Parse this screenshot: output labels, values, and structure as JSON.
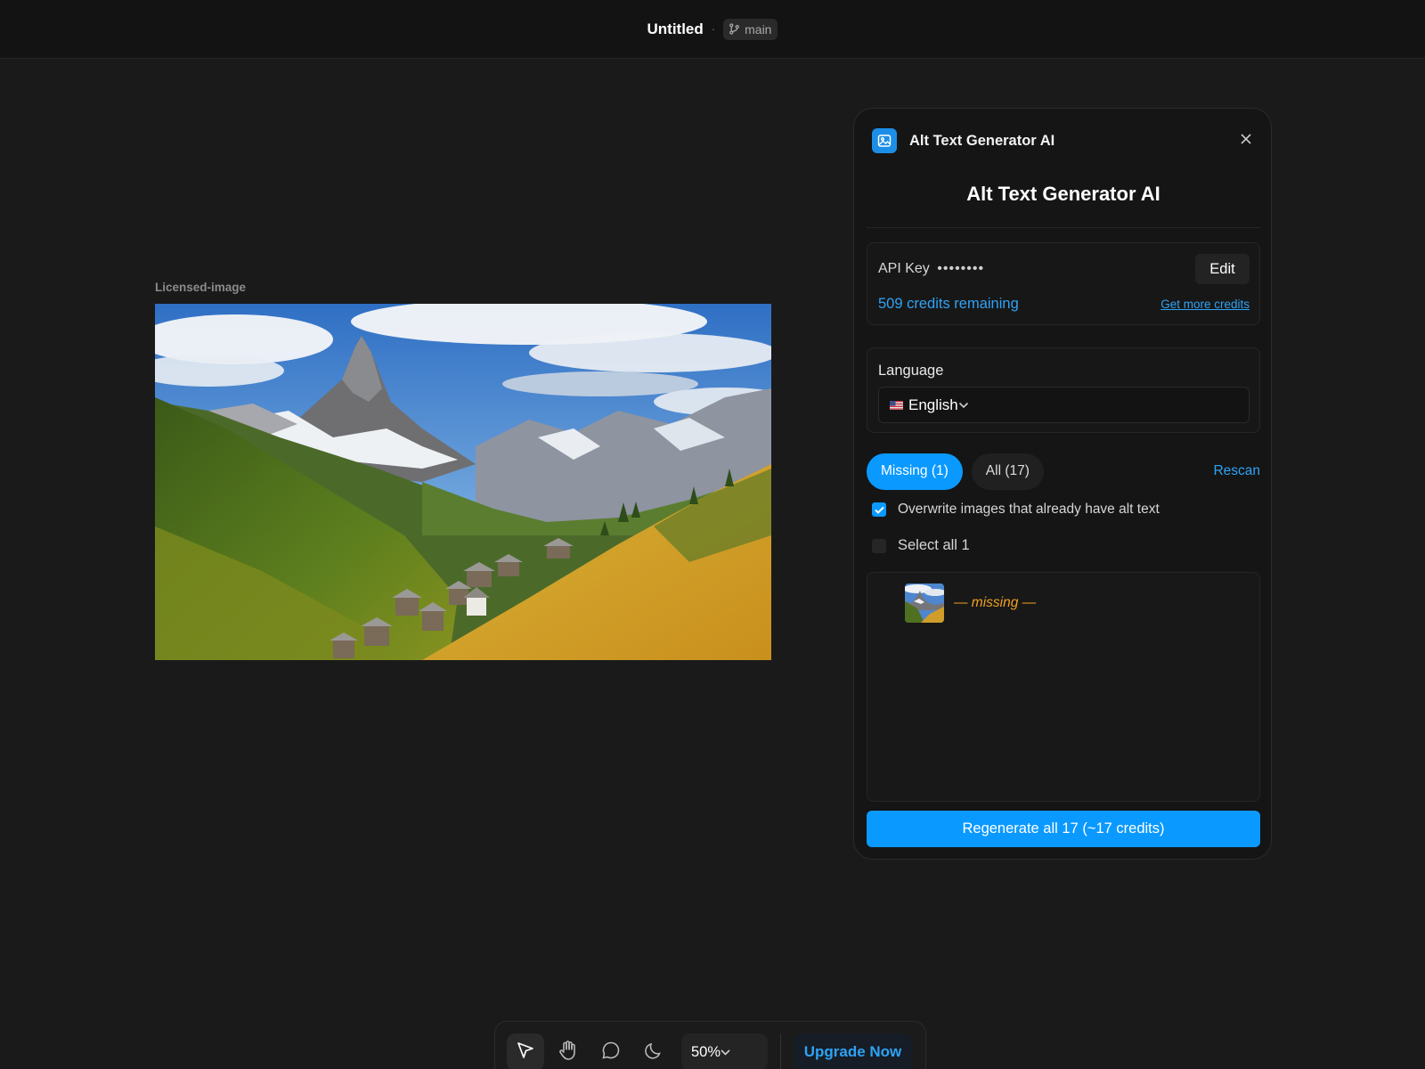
{
  "topbar": {
    "doc_title": "Untitled",
    "separator": "·",
    "branch_icon": "git-branch-icon",
    "branch_name": "main"
  },
  "canvas": {
    "frame_label": "Licensed-image"
  },
  "plugin": {
    "header_title": "Alt Text Generator AI",
    "heading": "Alt Text Generator AI",
    "api_key_label": "API Key",
    "api_key_masked": "••••••••",
    "edit_label": "Edit",
    "credits_text": "509 credits remaining",
    "get_more_credits_label": "Get more credits",
    "language_label": "Language",
    "language_value": "English",
    "tabs": [
      {
        "label": "Missing (1)",
        "active": true
      },
      {
        "label": "All (17)",
        "active": false
      }
    ],
    "rescan_label": "Rescan",
    "overwrite_label": "Overwrite images that already have alt text",
    "overwrite_checked": true,
    "select_all_label": "Select all 1",
    "select_all_checked": false,
    "items": [
      {
        "status_text": "— missing —"
      }
    ],
    "regenerate_label": "Regenerate all 17 (~17 credits)"
  },
  "toolbar": {
    "tools": [
      "cursor-icon",
      "hand-icon",
      "comment-icon",
      "moon-icon"
    ],
    "zoom_value": "50%",
    "upgrade_label": "Upgrade Now"
  },
  "colors": {
    "background": "#1a1a1a",
    "accent": "#0a99ff",
    "link": "#2fa3f5",
    "missing": "#f0a020"
  }
}
